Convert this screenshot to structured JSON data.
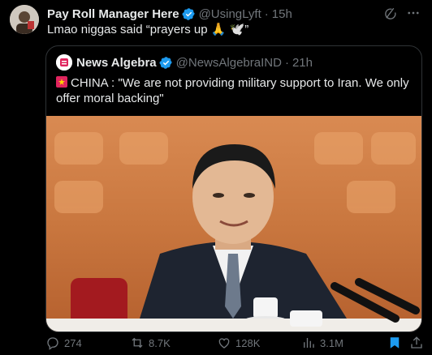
{
  "tweet": {
    "display_name": "Pay Roll Manager Here",
    "handle": "@UsingLyft",
    "separator": "·",
    "time": "15h",
    "text": "Lmao niggas said “prayers up 🙏 🕊️”"
  },
  "quote": {
    "display_name": "News Algebra",
    "handle": "@NewsAlgebraIND",
    "separator": "·",
    "time": "21h",
    "text": "CHINA : \"We are not providing military support to Iran. We only offer moral backing\""
  },
  "actions": {
    "replies": "274",
    "reposts": "8.7K",
    "likes": "128K",
    "views": "3.1M"
  },
  "icons": {
    "verified": "verified-badge-icon",
    "grok": "grok-icon",
    "more": "more-options-icon",
    "reply": "reply-icon",
    "repost": "repost-icon",
    "like": "heart-icon",
    "views": "views-chart-icon",
    "bookmark": "bookmark-icon",
    "share": "share-icon",
    "siren": "siren-icon"
  },
  "colors": {
    "background": "#000000",
    "text": "#e7e9ea",
    "muted": "#71767b",
    "verified": "#1d9bf0",
    "bookmarked": "#1d9bf0",
    "border": "#2f3336"
  }
}
